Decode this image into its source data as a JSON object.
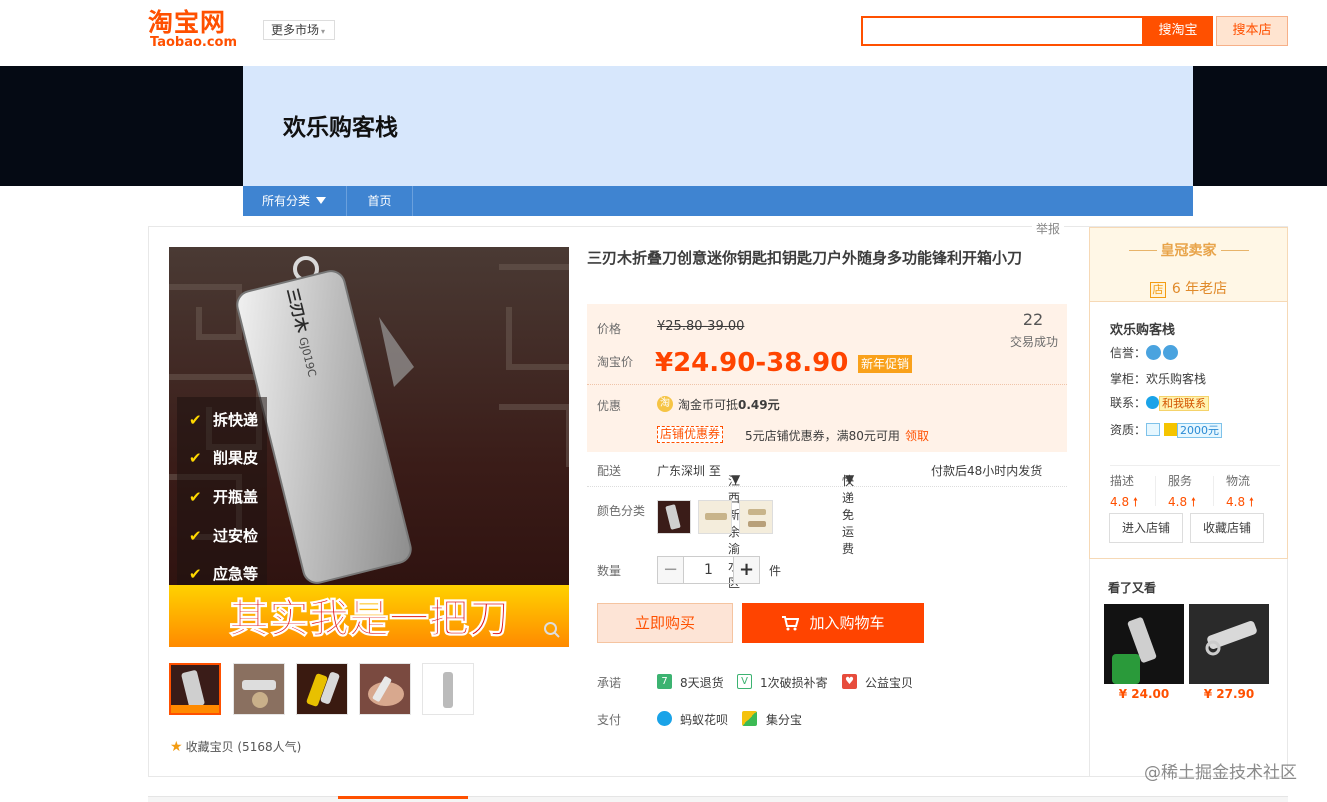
{
  "header": {
    "logo_cn": "淘宝网",
    "logo_en": "Taobao.com",
    "market_label": "更多市场",
    "search_button": "搜淘宝",
    "search_shop_button": "搜本店",
    "search_value": ""
  },
  "shop": {
    "name": "欢乐购客栈",
    "nav": [
      "所有分类",
      "首页"
    ]
  },
  "report_label": "举报",
  "product": {
    "title": "三刃木折叠刀创意迷你钥匙扣钥匙刀户外随身多功能锋利开箱小刀",
    "price_label": "价格",
    "orig_price": "¥25.80-39.00",
    "taobao_price_label": "淘宝价",
    "promo_price": "¥24.90-38.90",
    "promo_tag": "新年促销",
    "sales_count": "22",
    "sales_label": "交易成功",
    "discount_label": "优惠",
    "coin_text_prefix": "淘金币可抵",
    "coin_amount": "0.49元",
    "coupon_tag": "店铺优惠券",
    "coupon_text": "5元店铺优惠券，满80元可用",
    "coupon_get": "领取",
    "ship_label": "配送",
    "ship_from": "广东深圳 至",
    "ship_to": "江西新余渝水区",
    "ship_method": "快递 免运费",
    "ship_time": "付款后48小时内发货",
    "color_label": "颜色分类",
    "qty_label": "数量",
    "qty_value": "1",
    "qty_unit": "件",
    "buy_now": "立即购买",
    "add_cart": "加入购物车",
    "promise_label": "承诺",
    "promises": [
      "8天退货",
      "1次破损补寄",
      "公益宝贝"
    ],
    "pay_label": "支付",
    "payments": [
      "蚂蚁花呗",
      "集分宝"
    ],
    "fav_text": "收藏宝贝 (5168人气)",
    "image_overlay": {
      "features": [
        "拆快递",
        "削果皮",
        "开瓶盖",
        "过安检",
        "应急等"
      ],
      "slogan": "其实我是一把刀",
      "brand": "三刃木",
      "model": "GJ019C"
    }
  },
  "seller": {
    "level": "皇冠卖家",
    "age_icon": "店",
    "age": "6 年老店",
    "name": "欢乐购客栈",
    "credit_label": "信誉：",
    "owner_label": "掌柜：",
    "owner": "欢乐购客栈",
    "contact_label": "联系：",
    "contact_badge": "和我联系",
    "qual_label": "资质：",
    "deposit": "2000元",
    "scores": [
      {
        "label": "描述",
        "value": "4.8"
      },
      {
        "label": "服务",
        "value": "4.8"
      },
      {
        "label": "物流",
        "value": "4.8"
      }
    ],
    "enter_shop": "进入店铺",
    "fav_shop": "收藏店铺"
  },
  "seen": {
    "title": "看了又看",
    "items": [
      {
        "price": "¥ 24.00"
      },
      {
        "price": "¥ 27.90"
      }
    ]
  },
  "watermark": "@稀土掘金技术社区",
  "colors": {
    "accent": "#ff5000",
    "price": "#ff4400",
    "nav_blue": "#3f84d1",
    "banner_bg": "#d7e7fc"
  }
}
